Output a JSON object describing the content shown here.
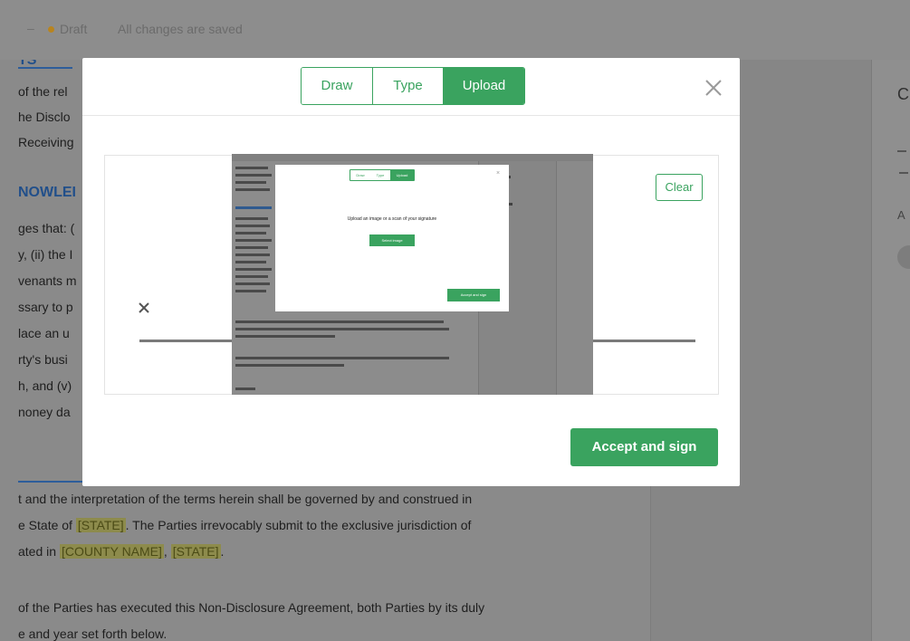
{
  "topbar": {
    "dash": "–",
    "status": "Draft",
    "saved": "All changes are saved"
  },
  "doc": {
    "heading_partial": "TS",
    "lines_upper": [
      "of the rel",
      "he Disclo",
      "Receiving"
    ],
    "heading2": "NOWLEI",
    "lines_mid": [
      "ges that: (",
      "y, (ii) the I",
      "venants m",
      "ssary to p",
      "lace an u",
      "rty's busi",
      "h, and (v)",
      "noney da"
    ],
    "law_line1": "t and the interpretation of the terms herein shall be governed by and construed in",
    "law_line2_a": "e State of ",
    "law_state": "[STATE]",
    "law_line2_b": ". The Parties irrevocably submit to the exclusive jurisdiction of",
    "law_line3_a": "ated in ",
    "law_county": "[COUNTY NAME]",
    "law_line3_sep": ", ",
    "law_state2": "[STATE]",
    "law_line3_end": ".",
    "witness_line1": "of the Parties has executed this Non-Disclosure Agreement, both Parties by its duly",
    "witness_line2": "e and year set forth below."
  },
  "far_panel": {
    "initial": "C",
    "letter": "A"
  },
  "modal": {
    "tabs": [
      {
        "label": "Draw",
        "active": false
      },
      {
        "label": "Type",
        "active": false
      },
      {
        "label": "Upload",
        "active": true
      }
    ],
    "close_icon": "close-icon",
    "clear_label": "Clear",
    "accept_label": "Accept and sign",
    "accent_color": "#3aa35f"
  },
  "uploaded_image": {
    "tabs": [
      "Draw",
      "Type",
      "Upload"
    ],
    "text": "Upload an image or a scan of your signature",
    "button": "Select image",
    "accept": "Accept and sign"
  }
}
